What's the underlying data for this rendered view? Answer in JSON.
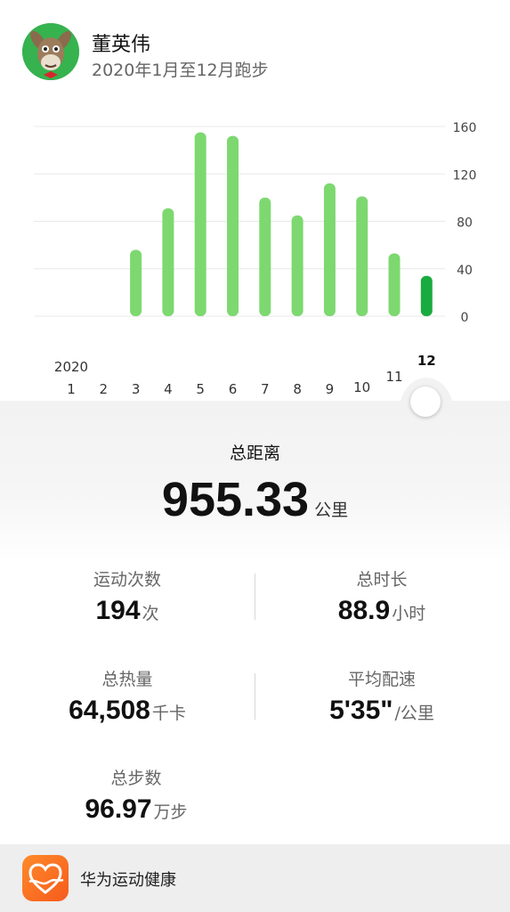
{
  "user": {
    "name": "董英伟",
    "subtitle": "2020年1月至12月跑步"
  },
  "chart_data": {
    "type": "bar",
    "year_label": "2020",
    "categories": [
      "1",
      "2",
      "3",
      "4",
      "5",
      "6",
      "7",
      "8",
      "9",
      "10",
      "11",
      "12"
    ],
    "values": [
      0,
      0,
      56,
      91,
      155,
      152,
      100,
      85,
      112,
      101,
      53,
      34
    ],
    "selected_index": 11,
    "ylim": [
      0,
      160
    ],
    "y_ticks": [
      "0",
      "40",
      "80",
      "120",
      "160"
    ],
    "colors": {
      "bar": "#7dd870",
      "selected": "#1aab40",
      "grid": "#e8e8e8",
      "tick": "#444444"
    }
  },
  "summary": {
    "total_label": "总距离",
    "total_value": "955.33",
    "total_unit": "公里"
  },
  "stats": {
    "count": {
      "label": "运动次数",
      "value": "194",
      "unit": "次"
    },
    "duration": {
      "label": "总时长",
      "value": "88.9",
      "unit": "小时"
    },
    "calories": {
      "label": "总热量",
      "value": "64,508",
      "unit": "千卡"
    },
    "pace": {
      "label": "平均配速",
      "value": "5'35\"",
      "unit": "/公里"
    },
    "steps": {
      "label": "总步数",
      "value": "96.97",
      "unit": "万步"
    }
  },
  "footer": {
    "app_name": "华为运动健康",
    "icon": "heart-health-icon"
  }
}
